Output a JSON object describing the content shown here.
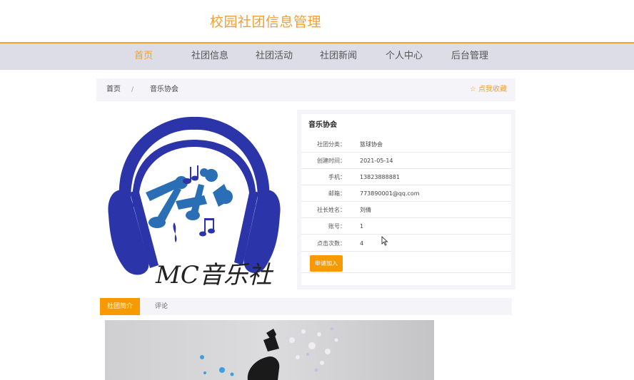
{
  "header": {
    "site_title": "校园社团信息管理"
  },
  "nav": {
    "items": [
      {
        "label": "首页",
        "active": true
      },
      {
        "label": "社团信息"
      },
      {
        "label": "社团活动"
      },
      {
        "label": "社团新闻"
      },
      {
        "label": "个人中心"
      },
      {
        "label": "后台管理"
      }
    ]
  },
  "breadcrumb": {
    "home": "首页",
    "sep": "/",
    "current": "音乐协会"
  },
  "favorite": {
    "icon": "star-icon",
    "label": "☆ 点我收藏"
  },
  "logo": {
    "text": "MC音乐社"
  },
  "club": {
    "name": "音乐协会",
    "rows": [
      {
        "label": "社团分类：",
        "value": "篮球协会"
      },
      {
        "label": "创建时间：",
        "value": "2021-05-14"
      },
      {
        "label": "手机：",
        "value": "13823888881"
      },
      {
        "label": "邮箱：",
        "value": "773890001@qq.com"
      },
      {
        "label": "社长姓名：",
        "value": "刘倩"
      },
      {
        "label": "账号：",
        "value": "1"
      },
      {
        "label": "点击次数：",
        "value": "4"
      }
    ],
    "join_label": "申请加入"
  },
  "tabs": [
    {
      "label": "社团简介",
      "active": true
    },
    {
      "label": "评论"
    }
  ],
  "colors": {
    "accent": "#f2a032",
    "button": "#f79a00",
    "nav_bg": "#dcdde6",
    "logo_blue": "#2b34a8"
  }
}
